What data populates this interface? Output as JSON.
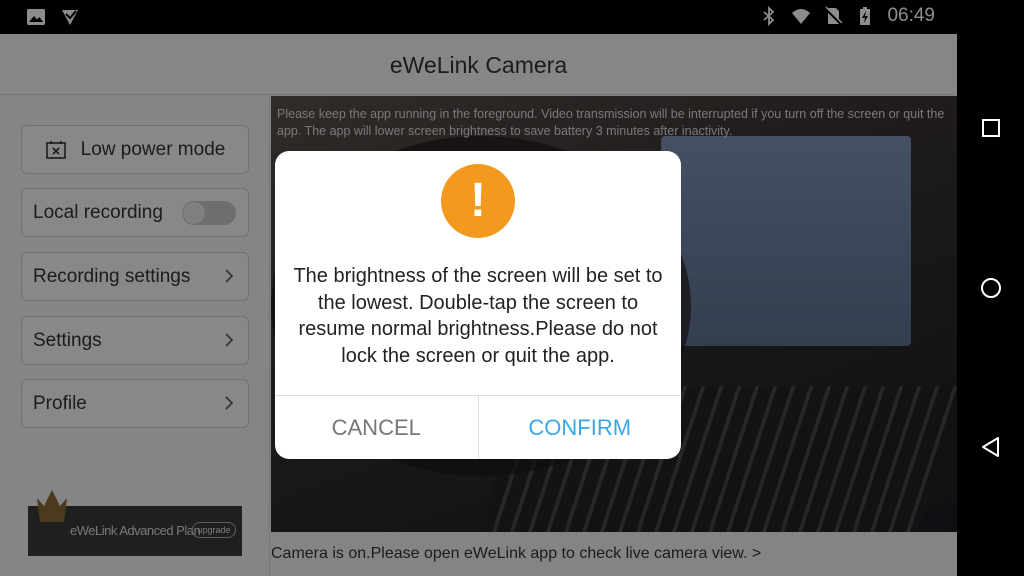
{
  "status_bar": {
    "time": "06:49",
    "left_icons": [
      "gallery-icon",
      "app-notification-icon"
    ],
    "right_icons": [
      "bluetooth-icon",
      "wifi-icon",
      "no-sim-icon",
      "battery-charging-icon"
    ]
  },
  "app": {
    "title": "eWeLink Camera"
  },
  "sidebar": {
    "low_power_label": "Low power mode",
    "local_recording_label": "Local recording",
    "local_recording_on": false,
    "recording_settings_label": "Recording settings",
    "settings_label": "Settings",
    "profile_label": "Profile",
    "banner_text": "eWeLink Advanced Plan",
    "banner_upgrade": "upgrade"
  },
  "camera": {
    "note": "Please keep the app running in the foreground. Video transmission will be interrupted if you turn off the screen or quit the app. The app will lower screen brightness to save battery 3 minutes after inactivity."
  },
  "footer": {
    "note": "Camera is on.Please open eWeLink app to check live camera view. >"
  },
  "dialog": {
    "icon": "exclamation-icon",
    "icon_glyph": "!",
    "message": "The brightness of the screen will be set to the lowest. Double-tap the screen to resume normal brightness.Please do not lock the screen or quit the app.",
    "cancel_label": "CANCEL",
    "confirm_label": "CONFIRM",
    "accent_color": "#f39a1e",
    "confirm_color": "#3aa7e8"
  },
  "nav_bar": {
    "buttons": [
      "recents-icon",
      "home-icon",
      "back-icon"
    ]
  }
}
